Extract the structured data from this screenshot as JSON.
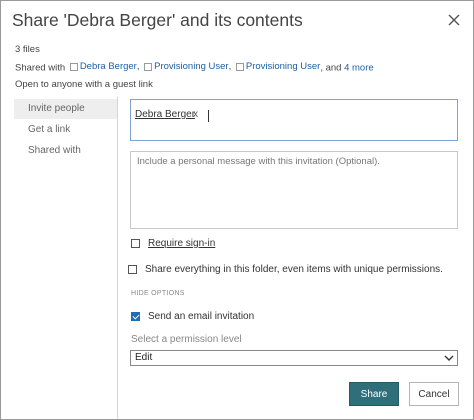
{
  "dialog": {
    "title": "Share 'Debra Berger' and its contents",
    "files_count": "3 files",
    "shared_with_prefix": "Shared with",
    "shared_users": [
      "Debra Berger",
      "Provisioning User",
      "Provisioning User"
    ],
    "shared_and": ", and",
    "shared_more": "4 more",
    "guest_link_text": "Open to anyone with a guest link"
  },
  "nav": {
    "items": [
      "Invite people",
      "Get a link",
      "Shared with"
    ],
    "active_index": 0
  },
  "invite": {
    "people": [
      {
        "name": "Debra Berger",
        "remove": "x"
      }
    ],
    "message_placeholder": "Include a personal message with this invitation (Optional).",
    "require_signin_label": "Require sign-in",
    "require_signin_checked": false,
    "share_everything_label": "Share everything in this folder, even items with unique permissions.",
    "share_everything_checked": false,
    "hide_options_label": "HIDE OPTIONS",
    "send_email_label": "Send an email invitation",
    "send_email_checked": true,
    "permission_label": "Select a permission level",
    "permission_value": "Edit"
  },
  "buttons": {
    "share": "Share",
    "cancel": "Cancel"
  },
  "colors": {
    "share_button": "#2e6f7a",
    "link": "#1f5fa0",
    "checkbox_checked": "#1f6fb2",
    "focus_border": "#7ea3cf"
  },
  "icons": [
    "close-icon",
    "user-icon",
    "chevron-down-icon",
    "checkmark-icon"
  ]
}
